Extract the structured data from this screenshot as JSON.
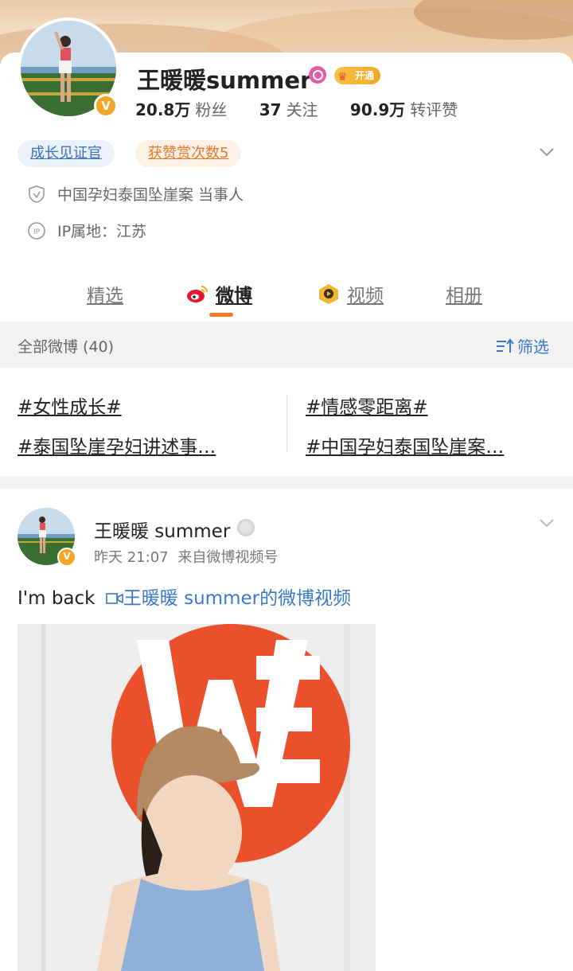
{
  "profile": {
    "username": "王暖暖summer",
    "verified_badge": "V",
    "vip_label": "开通",
    "stats": [
      {
        "value": "20.8万",
        "label": "粉丝"
      },
      {
        "value": "37",
        "label": "关注"
      },
      {
        "value": "90.9万",
        "label": "转评赞"
      }
    ],
    "tags": [
      "成长见证官",
      "获赞赏次数5"
    ],
    "description": "中国孕妇泰国坠崖案 当事人",
    "ip_location": "IP属地：江苏"
  },
  "tabs": [
    {
      "label": "精选",
      "active": false
    },
    {
      "label": "微博",
      "active": true
    },
    {
      "label": "视频",
      "active": false
    },
    {
      "label": "相册",
      "active": false
    }
  ],
  "filter": {
    "count_label": "全部微博 (40)",
    "filter_label": "筛选"
  },
  "topics": [
    "#女性成长#",
    "#情感零距离#",
    "#泰国坠崖孕妇讲述事…",
    "#中国孕妇泰国坠崖案…"
  ],
  "post": {
    "author": "王暖暖 summer",
    "time": "昨天 21:07",
    "source": "来自微博视频号",
    "text": "I'm back",
    "video_link": "王暖暖 summer的微博视频"
  },
  "colors": {
    "accent_orange": "#f27a26",
    "link_blue": "#3b78c7",
    "verify_gold": "#f3a623",
    "weibo_red": "#e6162d"
  }
}
